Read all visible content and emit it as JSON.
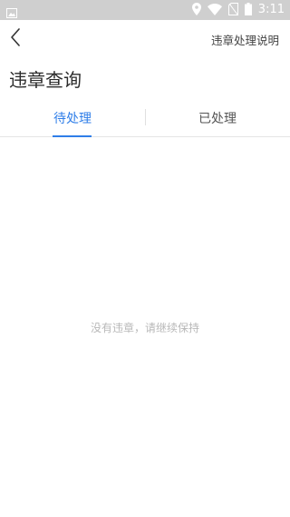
{
  "status_bar": {
    "time": "3:11",
    "icons": [
      "image-icon",
      "location-icon",
      "wifi-icon",
      "no-sim-icon",
      "battery-icon"
    ]
  },
  "header": {
    "back_icon": "chevron-left-icon",
    "help_link": "违章处理说明"
  },
  "page": {
    "title": "违章查询"
  },
  "tabs": [
    {
      "label": "待处理",
      "active": true
    },
    {
      "label": "已处理",
      "active": false
    }
  ],
  "content": {
    "empty_message": "没有违章，请继续保持"
  },
  "colors": {
    "accent": "#2f7ee8",
    "status_bar": "#cfcfcf",
    "empty_text": "#b8b8b8"
  }
}
